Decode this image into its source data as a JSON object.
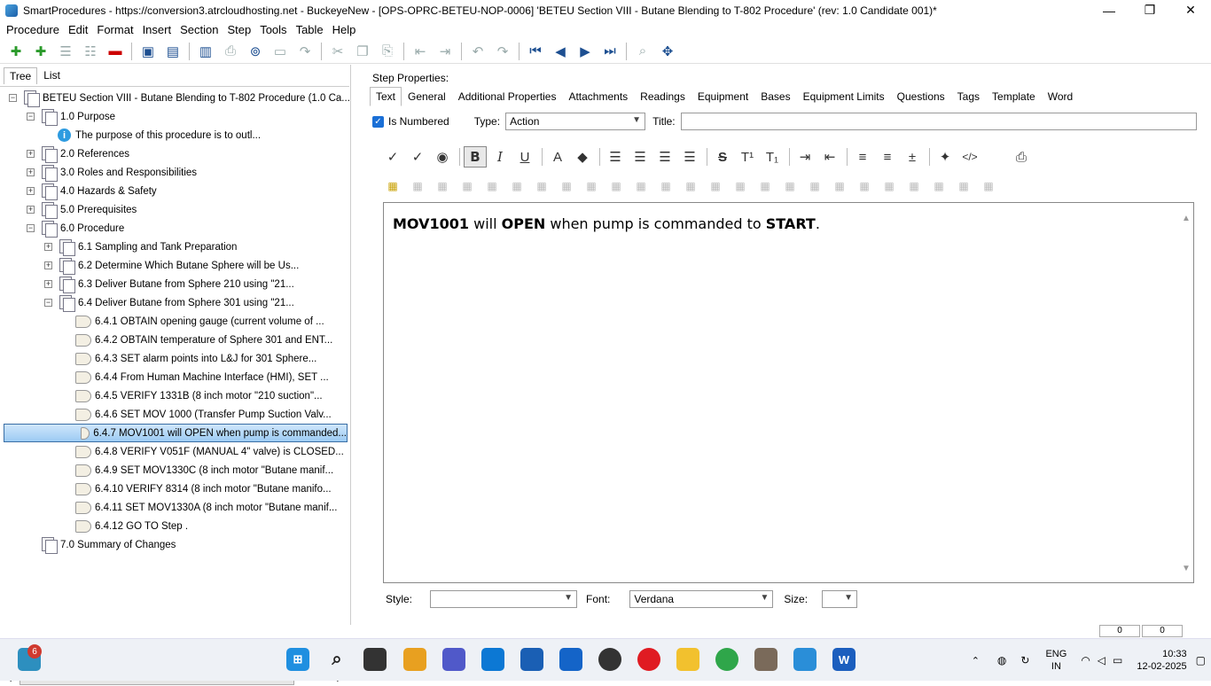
{
  "window": {
    "title": "SmartProcedures - https://conversion3.atrcloudhosting.net - BuckeyeNew - [OPS-OPRC-BETEU-NOP-0006] 'BETEU Section VIII - Butane Blending to T-802 Procedure' (rev: 1.0 Candidate 001)*",
    "controls": [
      "—",
      "❐",
      "✕"
    ]
  },
  "menu": [
    "Procedure",
    "Edit",
    "Format",
    "Insert",
    "Section",
    "Step",
    "Tools",
    "Table",
    "Help"
  ],
  "left_tabs": [
    "Tree",
    "List"
  ],
  "tree": [
    {
      "label": "BETEU Section VIII - Butane Blending to T-802 Procedure (1.0 Ca...",
      "level": 0,
      "exp": "−",
      "icon": "doc"
    },
    {
      "label": "1.0 Purpose",
      "level": 1,
      "exp": "−",
      "icon": "doc"
    },
    {
      "label": "The purpose of this procedure is to outl...",
      "level": 2,
      "exp": "",
      "icon": "info"
    },
    {
      "label": "2.0 References",
      "level": 1,
      "exp": "+",
      "icon": "doc"
    },
    {
      "label": "3.0 Roles and Responsibilities",
      "level": 1,
      "exp": "+",
      "icon": "doc"
    },
    {
      "label": "4.0 Hazards & Safety",
      "level": 1,
      "exp": "+",
      "icon": "doc"
    },
    {
      "label": "5.0 Prerequisites",
      "level": 1,
      "exp": "+",
      "icon": "doc"
    },
    {
      "label": "6.0 Procedure",
      "level": 1,
      "exp": "−",
      "icon": "doc"
    },
    {
      "label": "6.1 Sampling and Tank Preparation",
      "level": 2,
      "exp": "+",
      "icon": "doc"
    },
    {
      "label": "6.2 Determine Which Butane Sphere will be Us...",
      "level": 2,
      "exp": "+",
      "icon": "doc"
    },
    {
      "label": "6.3 Deliver Butane from Sphere 210 using \"21...",
      "level": 2,
      "exp": "+",
      "icon": "doc"
    },
    {
      "label": "6.4 Deliver Butane from Sphere 301 using \"21...",
      "level": 2,
      "exp": "−",
      "icon": "doc"
    },
    {
      "label": "6.4.1 OBTAIN opening gauge (current volume of ...",
      "level": 3,
      "exp": "",
      "icon": "hand"
    },
    {
      "label": "6.4.2 OBTAIN temperature of Sphere 301 and ENT...",
      "level": 3,
      "exp": "",
      "icon": "hand"
    },
    {
      "label": "6.4.3 SET alarm points into L&J for 301 Sphere...",
      "level": 3,
      "exp": "",
      "icon": "hand"
    },
    {
      "label": "6.4.4 From Human Machine Interface (HMI), SET ...",
      "level": 3,
      "exp": "",
      "icon": "hand"
    },
    {
      "label": "6.4.5 VERIFY 1331B (8 inch motor \"210 suction\"...",
      "level": 3,
      "exp": "",
      "icon": "hand"
    },
    {
      "label": "6.4.6 SET MOV 1000 (Transfer Pump Suction Valv...",
      "level": 3,
      "exp": "",
      "icon": "hand"
    },
    {
      "label": "6.4.7 MOV1001 will OPEN when pump is commanded...",
      "level": 3,
      "exp": "",
      "icon": "hand",
      "selected": true
    },
    {
      "label": "6.4.8 VERIFY V051F (MANUAL 4\" valve) is CLOSED...",
      "level": 3,
      "exp": "",
      "icon": "hand"
    },
    {
      "label": "6.4.9 SET MOV1330C (8 inch motor \"Butane manif...",
      "level": 3,
      "exp": "",
      "icon": "hand"
    },
    {
      "label": "6.4.10 VERIFY 8314 (8 inch motor \"Butane manifo...",
      "level": 3,
      "exp": "",
      "icon": "hand"
    },
    {
      "label": "6.4.11 SET MOV1330A (8 inch motor \"Butane manif...",
      "level": 3,
      "exp": "",
      "icon": "hand"
    },
    {
      "label": "6.4.12 GO TO Step .",
      "level": 3,
      "exp": "",
      "icon": "hand"
    },
    {
      "label": "7.0 Summary of Changes",
      "level": 1,
      "exp": "",
      "icon": "doc"
    }
  ],
  "step_props": {
    "heading": "Step Properties:",
    "tabs": [
      "Text",
      "General",
      "Additional Properties",
      "Attachments",
      "Readings",
      "Equipment",
      "Bases",
      "Equipment Limits",
      "Questions",
      "Tags",
      "Template",
      "Word"
    ],
    "is_numbered_label": "Is Numbered",
    "type_label": "Type:",
    "type_value": "Action",
    "title_label": "Title:",
    "title_value": ""
  },
  "editor": {
    "parts": [
      {
        "t": "MOV1001",
        "b": true
      },
      {
        "t": " will ",
        "b": false
      },
      {
        "t": "OPEN",
        "b": true
      },
      {
        "t": " when pump is commanded to ",
        "b": false
      },
      {
        "t": "START",
        "b": true
      },
      {
        "t": ".",
        "b": false
      }
    ]
  },
  "bottom": {
    "style_label": "Style:",
    "style_value": "",
    "font_label": "Font:",
    "font_value": "Verdana",
    "size_label": "Size:",
    "size_value": ""
  },
  "status": [
    "0",
    "0"
  ],
  "taskbar": {
    "badge": "6",
    "lang": "ENG",
    "region": "IN",
    "time": "10:33",
    "date": "12-02-2025"
  }
}
